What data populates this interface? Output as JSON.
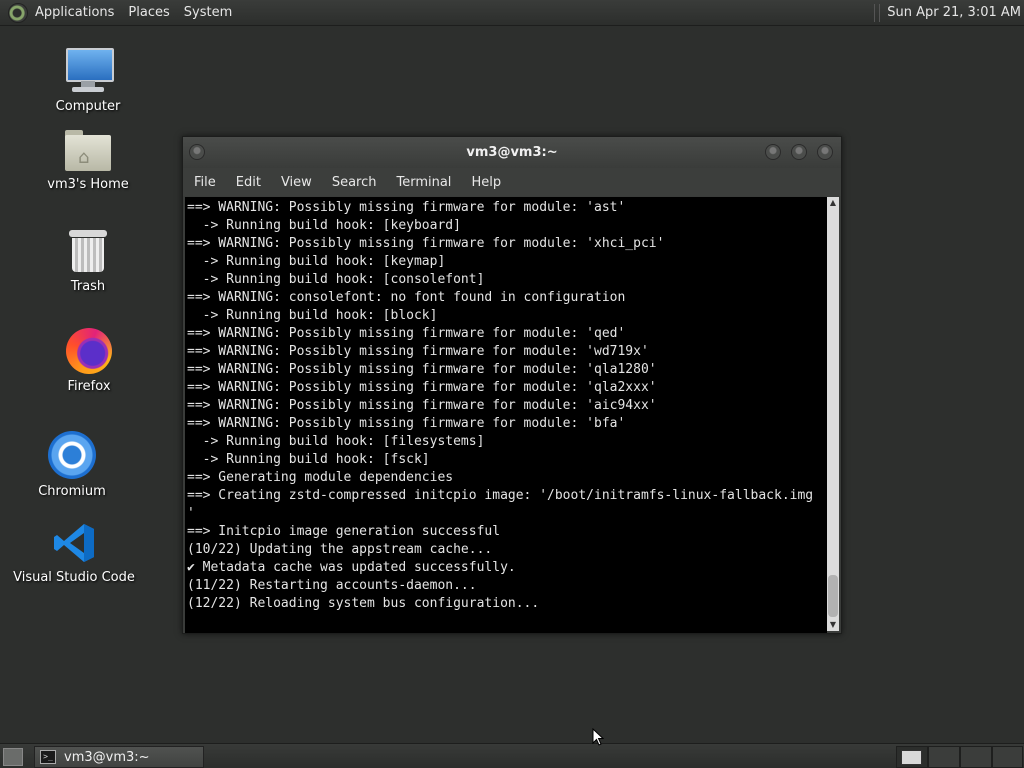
{
  "top_panel": {
    "menus": [
      "Applications",
      "Places",
      "System"
    ],
    "clock": "Sun Apr 21, 3:01 AM"
  },
  "desktop_icons": [
    {
      "label": "Computer",
      "icon": "computer-icon"
    },
    {
      "label": "vm3's Home",
      "icon": "home-folder-icon"
    },
    {
      "label": "Trash",
      "icon": "trash-icon"
    },
    {
      "label": "Firefox",
      "icon": "firefox-icon"
    },
    {
      "label": "Chromium",
      "icon": "chromium-icon"
    },
    {
      "label": "Visual Studio Code",
      "icon": "vscode-icon"
    }
  ],
  "terminal": {
    "title": "vm3@vm3:~",
    "menu": [
      "File",
      "Edit",
      "View",
      "Search",
      "Terminal",
      "Help"
    ],
    "lines": [
      "==> WARNING: Possibly missing firmware for module: 'ast'",
      "  -> Running build hook: [keyboard]",
      "==> WARNING: Possibly missing firmware for module: 'xhci_pci'",
      "  -> Running build hook: [keymap]",
      "  -> Running build hook: [consolefont]",
      "==> WARNING: consolefont: no font found in configuration",
      "  -> Running build hook: [block]",
      "==> WARNING: Possibly missing firmware for module: 'qed'",
      "==> WARNING: Possibly missing firmware for module: 'wd719x'",
      "==> WARNING: Possibly missing firmware for module: 'qla1280'",
      "==> WARNING: Possibly missing firmware for module: 'qla2xxx'",
      "==> WARNING: Possibly missing firmware for module: 'aic94xx'",
      "==> WARNING: Possibly missing firmware for module: 'bfa'",
      "  -> Running build hook: [filesystems]",
      "  -> Running build hook: [fsck]",
      "==> Generating module dependencies",
      "==> Creating zstd-compressed initcpio image: '/boot/initramfs-linux-fallback.img",
      "'",
      "==> Initcpio image generation successful",
      "(10/22) Updating the appstream cache...",
      "✔ Metadata cache was updated successfully.",
      "(11/22) Restarting accounts-daemon...",
      "(12/22) Reloading system bus configuration..."
    ],
    "scroll_position": 0.95
  },
  "taskbar": {
    "tasks": [
      {
        "label": "vm3@vm3:~",
        "icon": "terminal-icon"
      }
    ],
    "workspaces": 4,
    "active_workspace": 1
  }
}
